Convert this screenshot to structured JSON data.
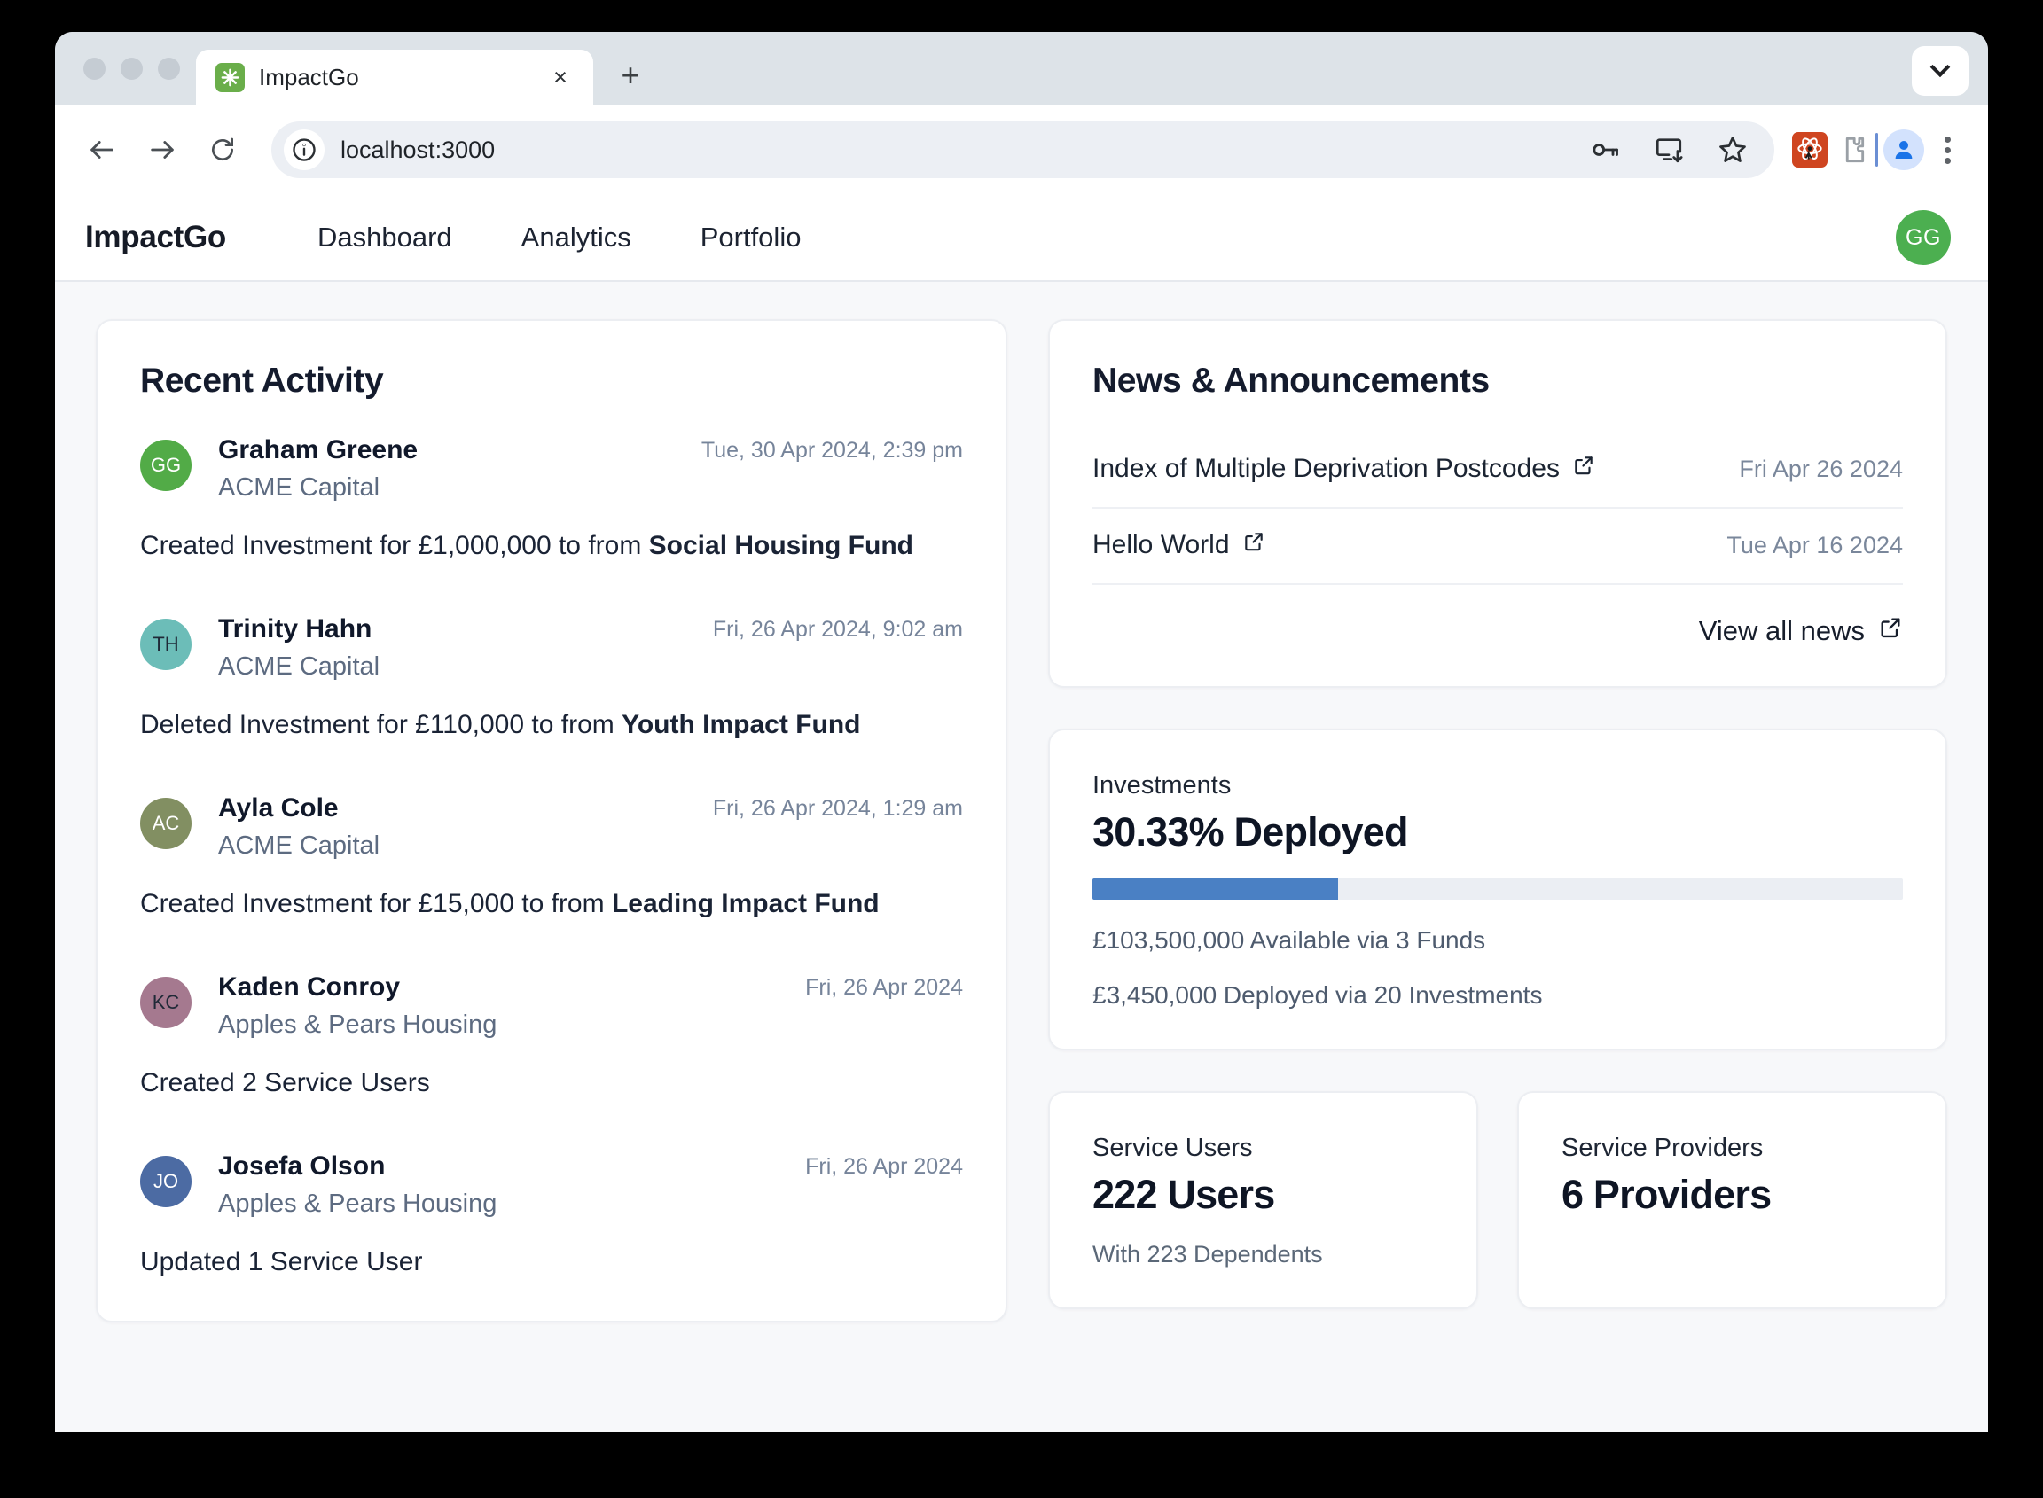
{
  "browser": {
    "tab": {
      "title": "ImpactGo",
      "favicon": "asterisk-icon",
      "close_label": "×"
    },
    "new_tab_label": "+",
    "url": "localhost:3000",
    "url_placeholder": "Search Google or type a URL",
    "toolbar_icons": [
      "key-icon",
      "install-app-icon",
      "bookmark-star-icon",
      "react-devtools-icon",
      "extensions-puzzle-icon",
      "profile-avatar-icon",
      "kebab-menu-icon"
    ],
    "tabstrip_menu": "chevron-down-icon"
  },
  "app": {
    "brand": "ImpactGo",
    "nav": [
      {
        "label": "Dashboard"
      },
      {
        "label": "Analytics"
      },
      {
        "label": "Portfolio"
      }
    ],
    "user_avatar": {
      "initials": "GG",
      "color": "#4caf50"
    }
  },
  "activity": {
    "title": "Recent Activity",
    "items": [
      {
        "initials": "GG",
        "color": "#52ab47",
        "initials_color": "#ffffff",
        "name": "Graham Greene",
        "org": "ACME Capital",
        "time": "Tue, 30 Apr 2024, 2:39 pm",
        "body_pre": "Created Investment for £1,000,000 to from ",
        "body_bold": "Social Housing Fund"
      },
      {
        "initials": "TH",
        "color": "#6cbdb8",
        "initials_color": "#1f2937",
        "name": "Trinity Hahn",
        "org": "ACME Capital",
        "time": "Fri, 26 Apr 2024, 9:02 am",
        "body_pre": "Deleted Investment for £110,000 to from ",
        "body_bold": "Youth Impact Fund"
      },
      {
        "initials": "AC",
        "color": "#828f62",
        "initials_color": "#ffffff",
        "name": "Ayla Cole",
        "org": "ACME Capital",
        "time": "Fri, 26 Apr 2024, 1:29 am",
        "body_pre": "Created Investment for £15,000 to from ",
        "body_bold": "Leading Impact Fund"
      },
      {
        "initials": "KC",
        "color": "#a5798f",
        "initials_color": "#1f2937",
        "name": "Kaden Conroy",
        "org": "Apples & Pears Housing",
        "time": "Fri, 26 Apr 2024",
        "body_pre": "Created 2 Service Users",
        "body_bold": ""
      },
      {
        "initials": "JO",
        "color": "#4c6ba3",
        "initials_color": "#ffffff",
        "name": "Josefa Olson",
        "org": "Apples & Pears Housing",
        "time": "Fri, 26 Apr 2024",
        "body_pre": "Updated 1 Service User",
        "body_bold": ""
      }
    ]
  },
  "news": {
    "title": "News & Announcements",
    "items": [
      {
        "title": "Index of Multiple Deprivation Postcodes",
        "date": "Fri Apr 26 2024",
        "icon": "external-link-icon"
      },
      {
        "title": "Hello World",
        "date": "Tue Apr 16 2024",
        "icon": "external-link-icon"
      }
    ],
    "view_all": "View all news"
  },
  "investments": {
    "label": "Investments",
    "headline": "30.33% Deployed",
    "progress_percent": 30.33,
    "bar_color": "#4a80c4",
    "track_color": "#ebeef3",
    "available_line": "£103,500,000 Available via 3 Funds",
    "deployed_line": "£3,450,000 Deployed via 20 Investments"
  },
  "service_users": {
    "label": "Service Users",
    "value": "222 Users",
    "sub": "With 223 Dependents"
  },
  "service_providers": {
    "label": "Service Providers",
    "value": "6 Providers",
    "sub": ""
  }
}
